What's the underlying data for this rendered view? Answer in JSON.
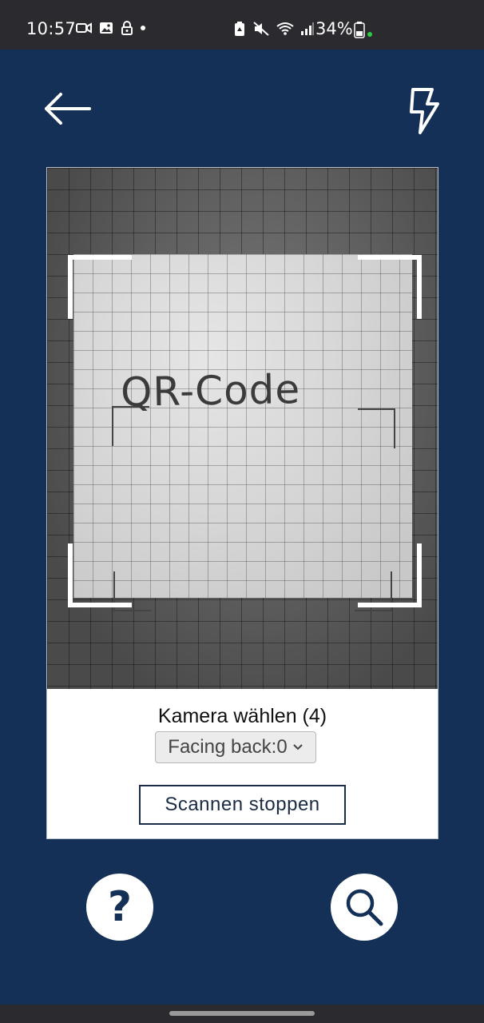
{
  "status_bar": {
    "time": "10:57",
    "battery": "34%",
    "icons": [
      "video-icon",
      "image-icon",
      "lock-icon",
      "notification-dot",
      "battery-saver-icon",
      "mute-icon",
      "wifi-icon",
      "signal-icon",
      "battery-icon"
    ]
  },
  "header": {
    "back_icon": "arrow-left-icon",
    "flash_icon": "flash-icon"
  },
  "scanner": {
    "camera_text": "QR-Code",
    "camera_label": "Kamera wählen (4)",
    "camera_selected": "Facing back:0",
    "stop_button": "Scannen stoppen"
  },
  "bottom": {
    "help_glyph": "?",
    "help_icon": "help-icon",
    "search_icon": "search-icon"
  },
  "colors": {
    "background": "#143057",
    "status_bar": "#2b2b2f",
    "card": "#ffffff",
    "button_border": "#1a2b45"
  }
}
